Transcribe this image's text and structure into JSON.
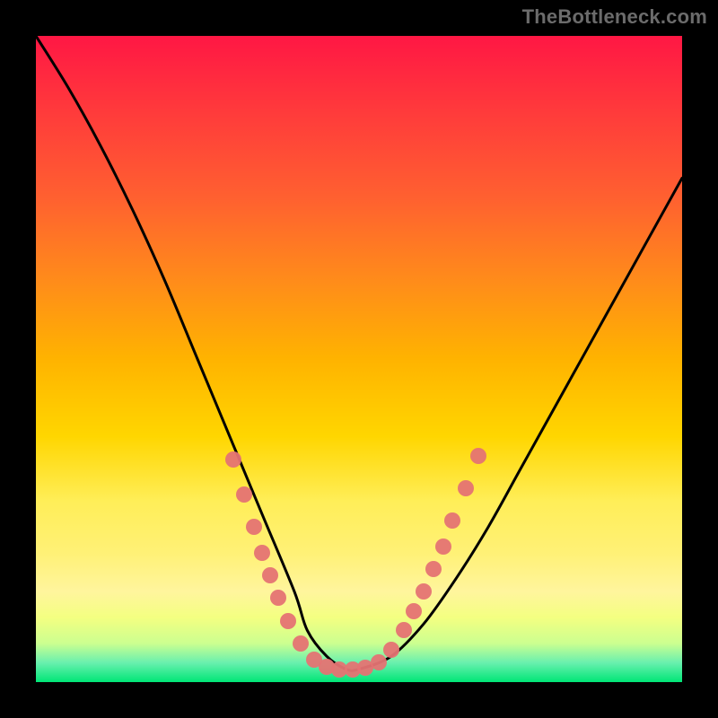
{
  "watermark": "TheBottleneck.com",
  "colors": {
    "dot": "#e57373",
    "curve": "#000000",
    "background_top": "#ff1744",
    "background_bottom": "#00e676",
    "frame": "#000000"
  },
  "chart_data": {
    "type": "line",
    "title": "",
    "xlabel": "",
    "ylabel": "",
    "xlim": [
      0,
      100
    ],
    "ylim": [
      0,
      100
    ],
    "grid": false,
    "legend": false,
    "series": [
      {
        "name": "curve",
        "x": [
          0,
          5,
          10,
          15,
          20,
          25,
          30,
          35,
          40,
          42,
          45,
          48,
          50,
          55,
          60,
          65,
          70,
          75,
          80,
          85,
          90,
          95,
          100
        ],
        "y": [
          100,
          92,
          83,
          73,
          62,
          50,
          38,
          26,
          14,
          8,
          4,
          2,
          2,
          4,
          9,
          16,
          24,
          33,
          42,
          51,
          60,
          69,
          78
        ]
      }
    ],
    "markers": [
      {
        "x": 30.5,
        "y": 34.5
      },
      {
        "x": 32.2,
        "y": 29.0
      },
      {
        "x": 33.8,
        "y": 24.0
      },
      {
        "x": 35.0,
        "y": 20.0
      },
      {
        "x": 36.2,
        "y": 16.5
      },
      {
        "x": 37.5,
        "y": 13.0
      },
      {
        "x": 39.0,
        "y": 9.5
      },
      {
        "x": 41.0,
        "y": 6.0
      },
      {
        "x": 43.0,
        "y": 3.5
      },
      {
        "x": 45.0,
        "y": 2.3
      },
      {
        "x": 47.0,
        "y": 2.0
      },
      {
        "x": 49.0,
        "y": 2.0
      },
      {
        "x": 51.0,
        "y": 2.2
      },
      {
        "x": 53.0,
        "y": 3.0
      },
      {
        "x": 55.0,
        "y": 5.0
      },
      {
        "x": 57.0,
        "y": 8.0
      },
      {
        "x": 58.5,
        "y": 11.0
      },
      {
        "x": 60.0,
        "y": 14.0
      },
      {
        "x": 61.5,
        "y": 17.5
      },
      {
        "x": 63.0,
        "y": 21.0
      },
      {
        "x": 64.5,
        "y": 25.0
      },
      {
        "x": 66.5,
        "y": 30.0
      },
      {
        "x": 68.5,
        "y": 35.0
      }
    ]
  }
}
